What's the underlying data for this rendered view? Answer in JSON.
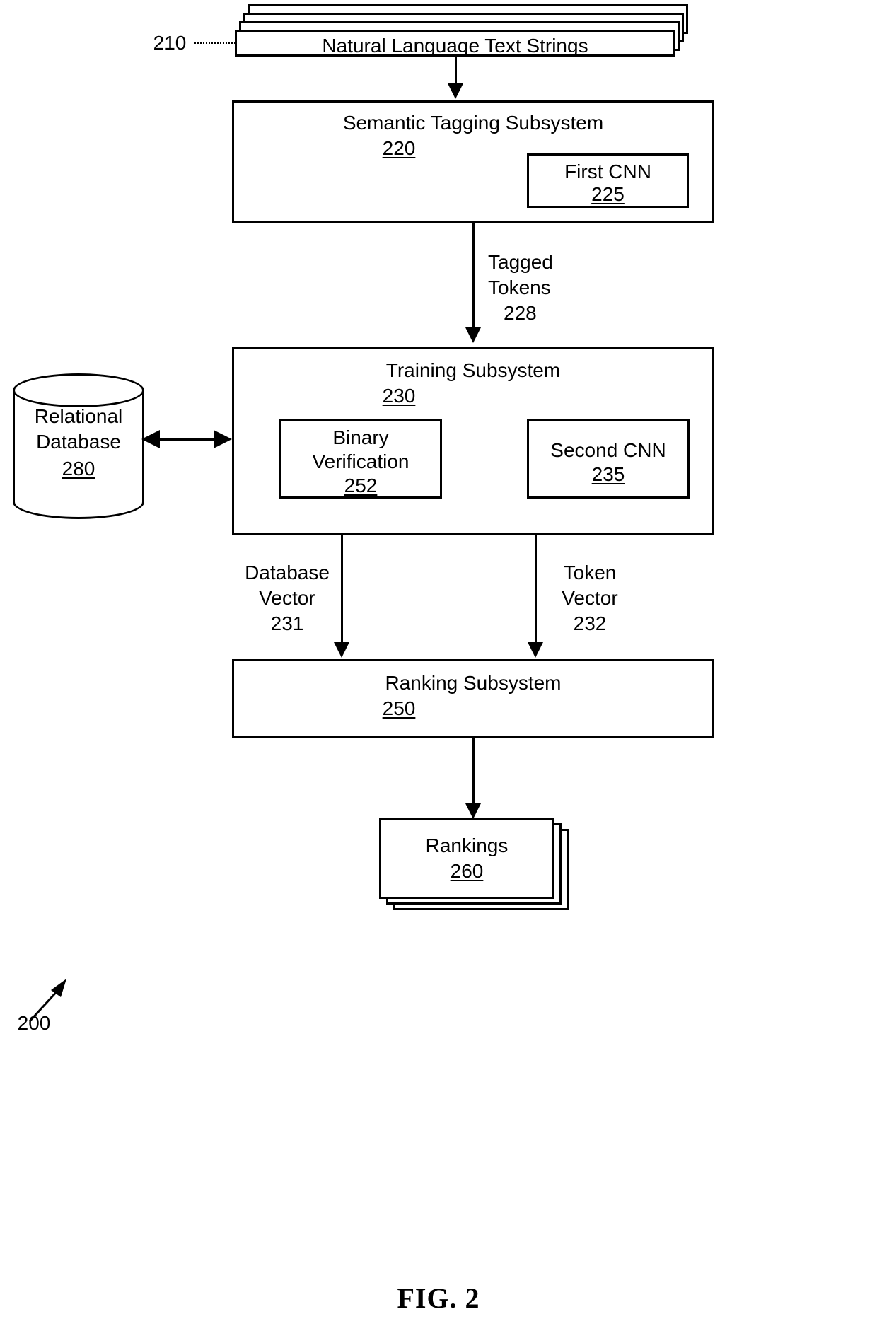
{
  "figure": {
    "caption": "FIG. 2",
    "system_ref": "200"
  },
  "nodes": {
    "text_strings": {
      "ref_callout": "210",
      "label": "Natural Language Text Strings",
      "stack_count": 4
    },
    "semantic_tagging": {
      "title": "Semantic Tagging Subsystem",
      "ref": "220",
      "child": {
        "title": "First CNN",
        "ref": "225"
      }
    },
    "training": {
      "title": "Training Subsystem",
      "ref": "230",
      "children": [
        {
          "title_line1": "Binary",
          "title_line2": "Verification",
          "ref": "252"
        },
        {
          "title_line1": "Second CNN",
          "title_line2": "",
          "ref": "235"
        }
      ]
    },
    "relational_database": {
      "line1": "Relational",
      "line2": "Database",
      "ref": "280"
    },
    "ranking": {
      "title": "Ranking Subsystem",
      "ref": "250"
    },
    "rankings": {
      "title": "Rankings",
      "ref": "260",
      "stack_count": 3
    }
  },
  "edges": {
    "tagged_tokens": {
      "line1": "Tagged",
      "line2": "Tokens",
      "ref": "228"
    },
    "database_vector": {
      "line1": "Database",
      "line2": "Vector",
      "ref": "231"
    },
    "token_vector": {
      "line1": "Token",
      "line2": "Vector",
      "ref": "232"
    }
  },
  "colors": {
    "stroke": "#000000",
    "background": "#ffffff"
  }
}
